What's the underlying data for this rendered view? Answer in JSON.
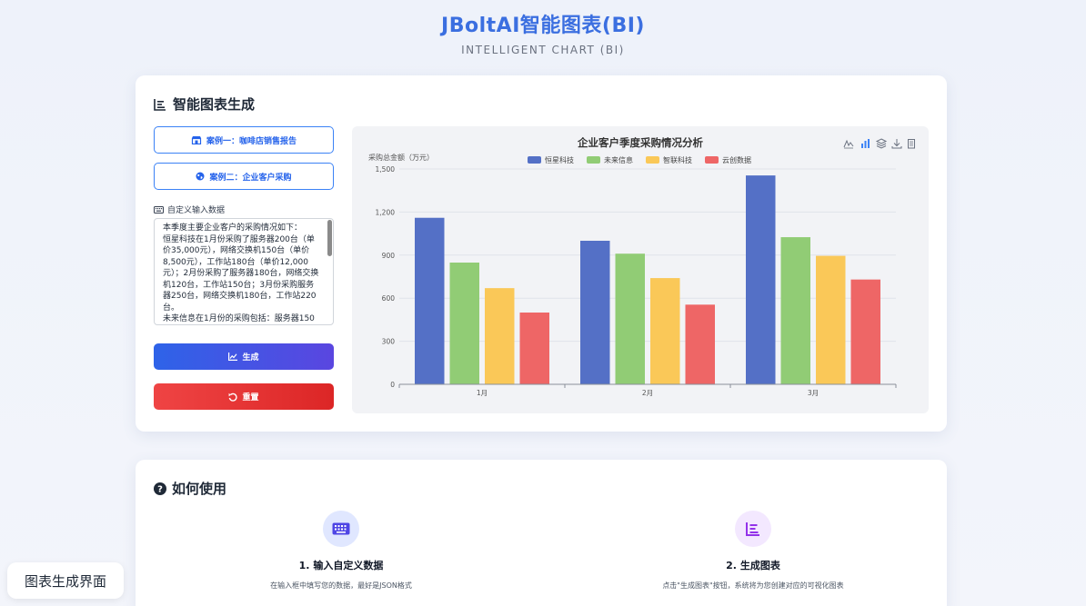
{
  "header": {
    "title": "JBoltAI智能图表(BI)",
    "subtitle": "INTELLIGENT CHART (BI)"
  },
  "main": {
    "section_title": "智能图表生成",
    "example1_label": "案例一：咖啡店销售报告",
    "example2_label": "案例二：企业客户采购",
    "custom_label": "自定义输入数据",
    "textarea_value": "本季度主要企业客户的采购情况如下：\n恒星科技在1月份采购了服务器200台（单价35,000元），网络交换机150台（单价8,500元），工作站180台（单价12,000元）；2月份采购了服务器180台，网络交换机120台，工作站150台；3月份采购服务器250台，网络交换机180台，工作站220台。\n未来信息在1月份的采购包括：服务器150",
    "generate_label": "生成",
    "reset_label": "重置"
  },
  "chart_data": {
    "type": "bar",
    "title": "企业客户季度采购情况分析",
    "ylabel": "采购总金额（万元）",
    "xlabel": "",
    "categories": [
      "1月",
      "2月",
      "3月"
    ],
    "ylim": [
      0,
      1500
    ],
    "yticks": [
      "0",
      "300",
      "600",
      "900",
      "1,200",
      "1,500"
    ],
    "grid": true,
    "legend_position": "top",
    "series": [
      {
        "name": "恒星科技",
        "color": "#5470c6",
        "values": [
          1160,
          1000,
          1455
        ]
      },
      {
        "name": "未来信息",
        "color": "#91cc75",
        "values": [
          848,
          910,
          1025
        ]
      },
      {
        "name": "智联科技",
        "color": "#fac858",
        "values": [
          670,
          740,
          895
        ]
      },
      {
        "name": "云创数据",
        "color": "#ee6666",
        "values": [
          500,
          555,
          730
        ]
      }
    ],
    "toolbox": [
      "line-chart-icon",
      "bar-chart-icon",
      "stack-icon",
      "download-icon",
      "data-view-icon"
    ]
  },
  "help": {
    "title": "如何使用",
    "step1_title": "1. 输入自定义数据",
    "step1_desc": "在输入框中填写您的数据，最好是JSON格式",
    "step2_title": "2. 生成图表",
    "step2_desc": "点击\"生成图表\"按钮，系统将为您创建对应的可视化图表"
  },
  "caption": "图表生成界面",
  "colors": {
    "accent": "#3b6fe0",
    "generate_gradient": [
      "#2e63e8",
      "#5a46e0"
    ],
    "reset_gradient": [
      "#ef4444",
      "#dc2626"
    ]
  }
}
